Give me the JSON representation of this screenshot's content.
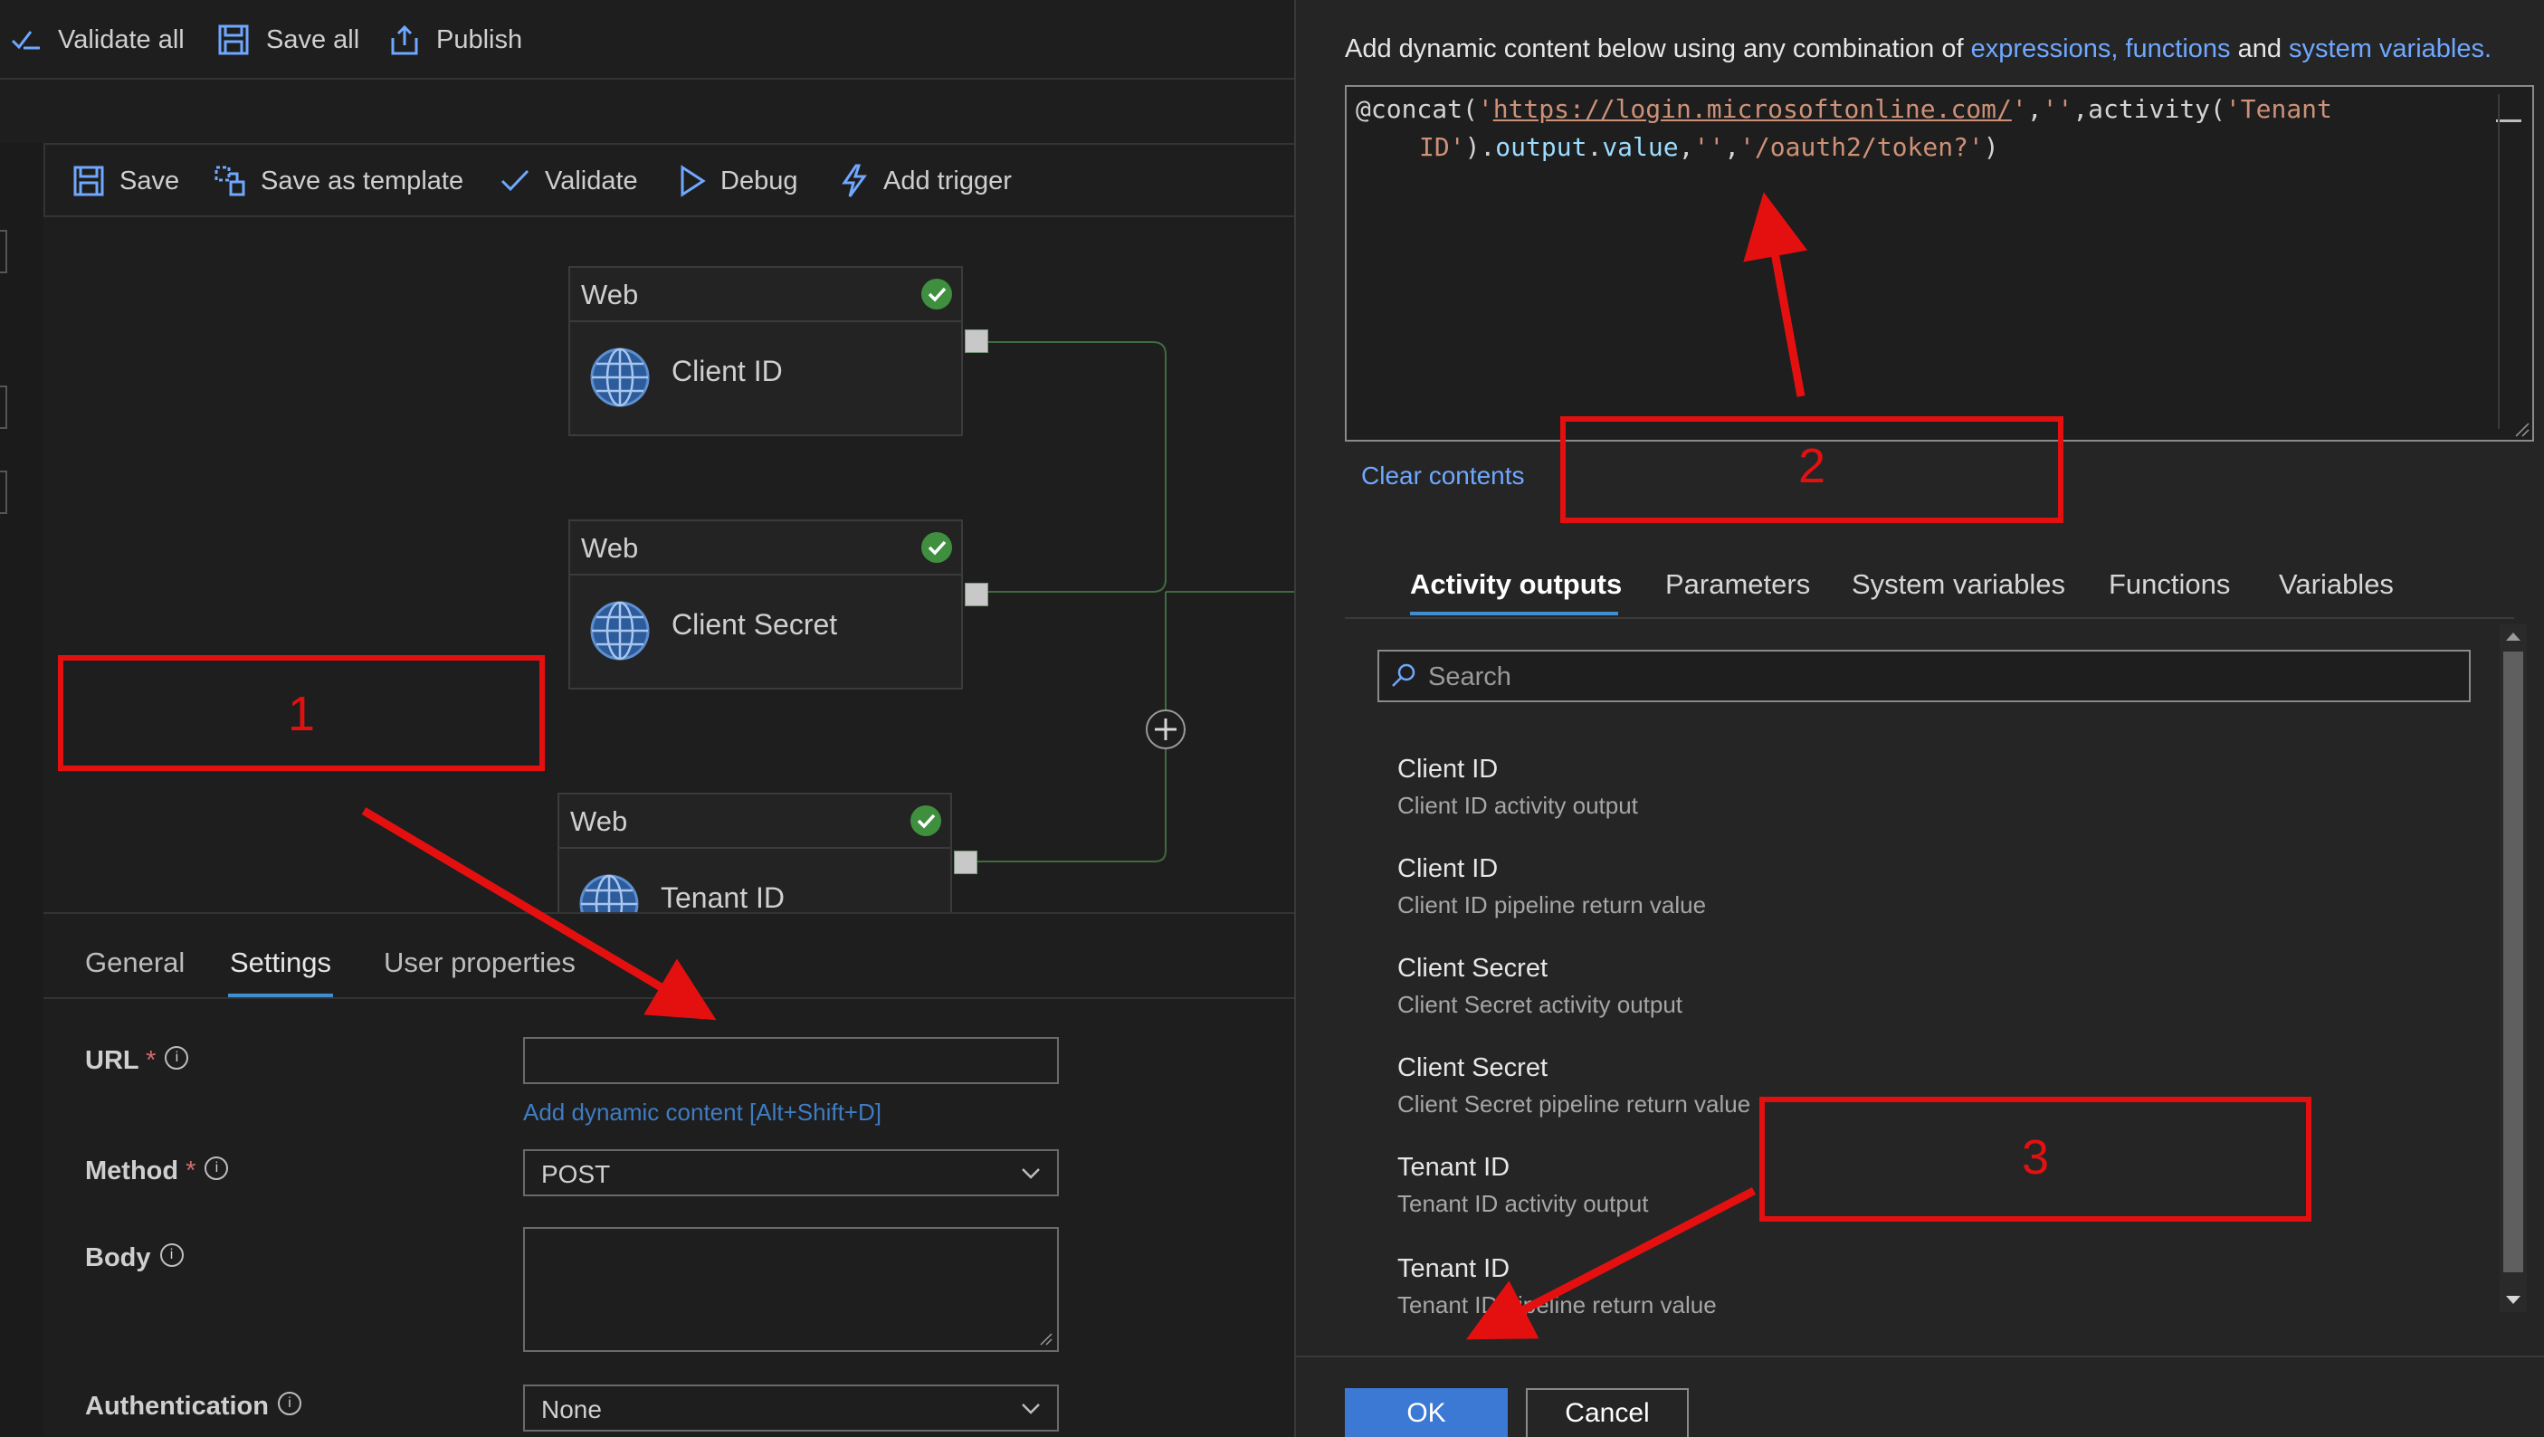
{
  "top_toolbar": {
    "validate_all": "Validate all",
    "save_all": "Save all",
    "publish": "Publish"
  },
  "pipeline_toolbar": {
    "save": "Save",
    "save_as_template": "Save as template",
    "validate": "Validate",
    "debug": "Debug",
    "add_trigger": "Add trigger"
  },
  "canvas": {
    "nodes": [
      {
        "type": "Web",
        "name": "Client ID"
      },
      {
        "type": "Web",
        "name": "Client Secret"
      },
      {
        "type": "Web",
        "name": "Tenant ID"
      }
    ]
  },
  "properties": {
    "tabs": [
      "General",
      "Settings",
      "User properties"
    ],
    "active_tab": "Settings",
    "url_label": "URL",
    "url_value": "",
    "add_dynamic_content": "Add dynamic content [Alt+Shift+D]",
    "method_label": "Method",
    "method_value": "POST",
    "body_label": "Body",
    "authentication_label": "Authentication",
    "authentication_value": "None",
    "required_mark": "*",
    "info_glyph": "i"
  },
  "dynamic_content": {
    "intro_prefix": "Add dynamic content below using any combination of ",
    "intro_link1": "expressions, functions",
    "intro_and": " and ",
    "intro_link2": "system variables.",
    "code_line1": {
      "a": "@concat(",
      "b": "'",
      "c": "https://login.microsoftonline.com/",
      "d": "'",
      "e": ",",
      "f": "''",
      "g": ",activity(",
      "h": "'Tenant"
    },
    "code_line2": {
      "a": "ID'",
      "b": ").",
      "c": "output",
      "d": ".",
      "e": "value",
      "f": ",",
      "g": "''",
      "h": ",",
      "i": "'/oauth2/token?'",
      "j": ")"
    },
    "clear_contents": "Clear contents",
    "tabs": [
      "Activity outputs",
      "Parameters",
      "System variables",
      "Functions",
      "Variables"
    ],
    "active_tab": "Activity outputs",
    "search_placeholder": "Search",
    "items": [
      {
        "title": "Client ID",
        "subtitle": "Client ID activity output"
      },
      {
        "title": "Client ID",
        "subtitle": "Client ID pipeline return value"
      },
      {
        "title": "Client Secret",
        "subtitle": "Client Secret activity output"
      },
      {
        "title": "Client Secret",
        "subtitle": "Client Secret pipeline return value"
      },
      {
        "title": "Tenant ID",
        "subtitle": "Tenant ID activity output"
      },
      {
        "title": "Tenant ID",
        "subtitle": "Tenant ID pipeline return value"
      }
    ],
    "ok": "OK",
    "cancel": "Cancel"
  },
  "annotations": {
    "box1": "1",
    "box2": "2",
    "box3": "3",
    "color": "#e41010"
  },
  "colors": {
    "accent": "#3e8ed0",
    "link": "#6fa8ff",
    "success": "#3f8f3f",
    "ok_button": "#3b79d4"
  }
}
